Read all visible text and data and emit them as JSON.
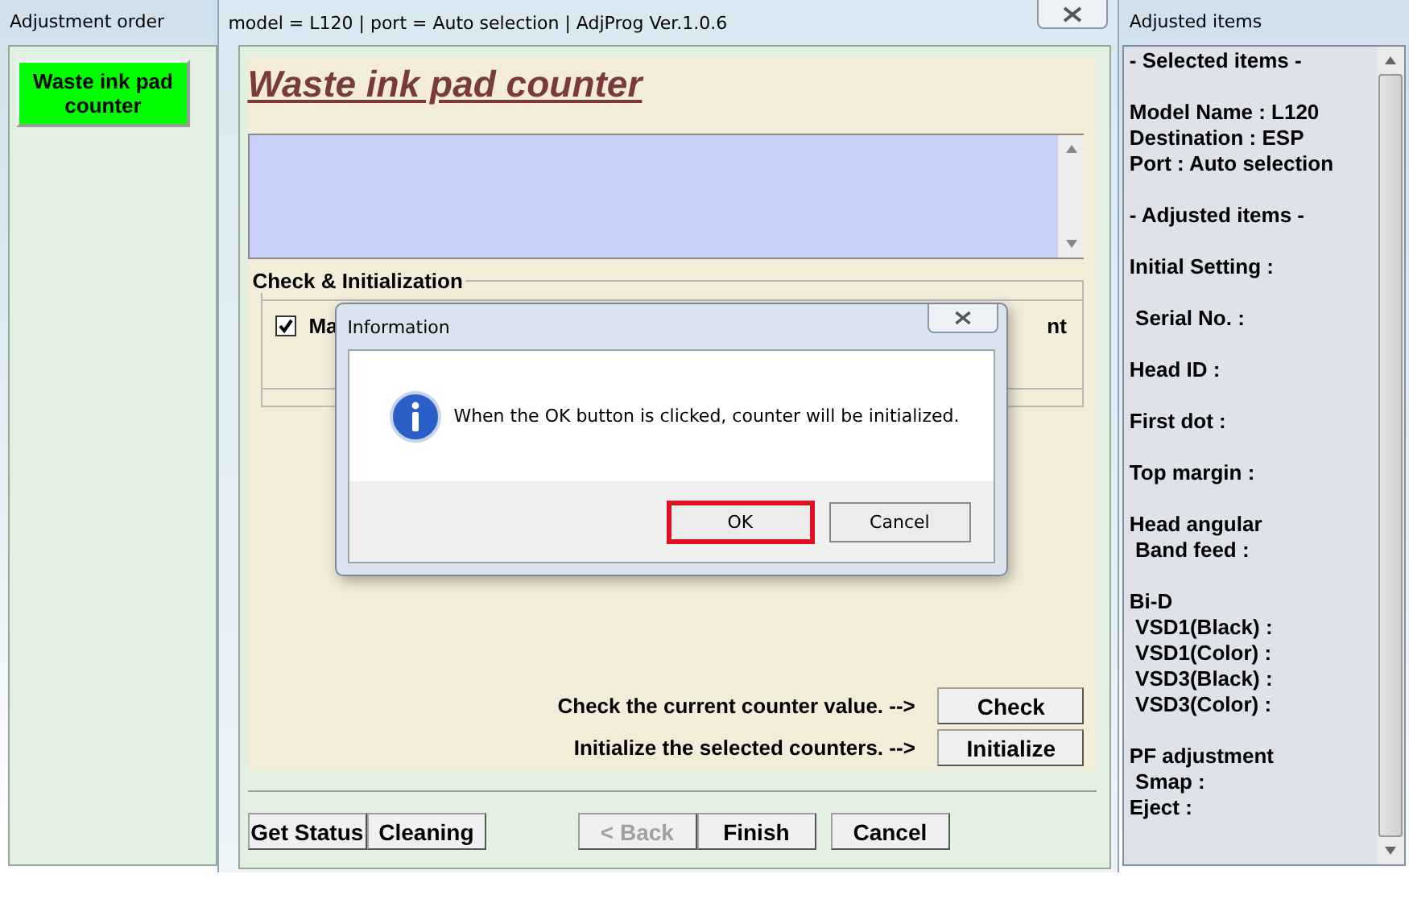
{
  "left_window": {
    "title": "Adjustment order",
    "items": [
      {
        "label": "Waste ink pad counter",
        "selected": true
      }
    ]
  },
  "main_window": {
    "title": "model = L120 | port = Auto selection | AdjProg Ver.1.0.6",
    "heading": "Waste ink pad counter",
    "group": {
      "title": "Check & Initialization",
      "checkbox": {
        "label": "Ma",
        "checked": true
      },
      "trailing_text": "nt"
    },
    "actions": [
      {
        "label": "Check the current counter value. -->",
        "button": "Check"
      },
      {
        "label": "Initialize the selected counters. -->",
        "button": "Initialize"
      }
    ],
    "footer_buttons": [
      {
        "label": "Get Status",
        "disabled": false
      },
      {
        "label": "Cleaning",
        "disabled": false
      },
      {
        "label": "< Back",
        "disabled": true
      },
      {
        "label": "Finish",
        "disabled": false
      },
      {
        "label": "Cancel",
        "disabled": false
      }
    ]
  },
  "dialog": {
    "title": "Information",
    "message": "When the OK button is clicked, counter will be initialized.",
    "buttons": [
      {
        "label": "OK",
        "highlighted": true
      },
      {
        "label": "Cancel",
        "highlighted": false
      }
    ]
  },
  "right_window": {
    "title": "Adjusted items",
    "sections": [
      [
        "- Selected items -"
      ],
      [
        "Model Name : L120",
        "Destination : ESP",
        "Port : Auto selection"
      ],
      [
        "- Adjusted items -"
      ],
      [
        "Initial Setting :"
      ],
      [
        " Serial No. :"
      ],
      [
        "Head ID :"
      ],
      [
        "First dot :"
      ],
      [
        "Top margin :"
      ],
      [
        "Head angular",
        " Band feed :"
      ],
      [
        "Bi-D",
        " VSD1(Black) :",
        " VSD1(Color) :",
        " VSD3(Black) :",
        " VSD3(Color) :"
      ],
      [
        "PF adjustment",
        " Smap :",
        "Eject :"
      ]
    ]
  }
}
